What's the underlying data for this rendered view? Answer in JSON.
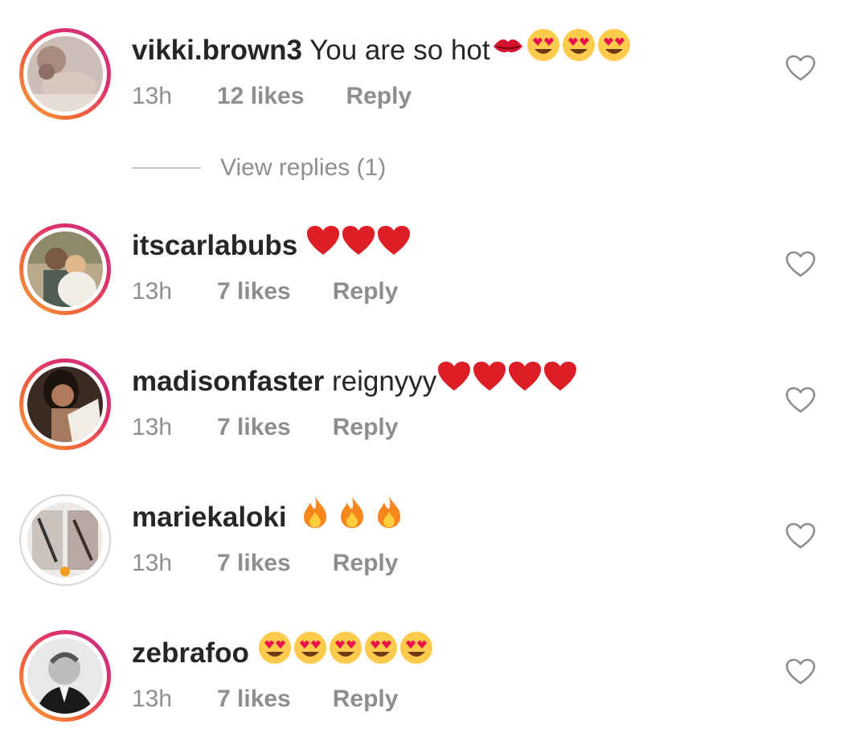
{
  "comments": [
    {
      "username": "vikki.brown3",
      "text": "You are so hot",
      "emojis": [
        "kiss-mark",
        "heart-eyes",
        "heart-eyes",
        "heart-eyes"
      ],
      "time": "13h",
      "likes": "12 likes",
      "reply": "Reply",
      "avatar_ring": "story"
    },
    {
      "username": "itscarlabubs",
      "text": "",
      "emojis": [
        "red-heart",
        "red-heart",
        "red-heart"
      ],
      "time": "13h",
      "likes": "7 likes",
      "reply": "Reply",
      "avatar_ring": "story"
    },
    {
      "username": "madisonfaster",
      "text": "reignyyy",
      "emojis": [
        "red-heart",
        "red-heart",
        "red-heart",
        "red-heart"
      ],
      "time": "13h",
      "likes": "7 likes",
      "reply": "Reply",
      "avatar_ring": "story"
    },
    {
      "username": "mariekaloki",
      "text": "",
      "emojis": [
        "fire",
        "fire",
        "fire"
      ],
      "time": "13h",
      "likes": "7 likes",
      "reply": "Reply",
      "avatar_ring": "none"
    },
    {
      "username": "zebrafoo",
      "text": "",
      "emojis": [
        "heart-eyes",
        "heart-eyes",
        "heart-eyes",
        "heart-eyes",
        "heart-eyes"
      ],
      "time": "13h",
      "likes": "7 likes",
      "reply": "Reply",
      "avatar_ring": "story"
    }
  ],
  "view_replies": "View replies (1)",
  "colors": {
    "username": "#262626",
    "meta": "#8e8e8e",
    "story_ring_start": "#f7a437",
    "story_ring_end": "#c13584",
    "heart_outline": "#8e8e8e"
  }
}
